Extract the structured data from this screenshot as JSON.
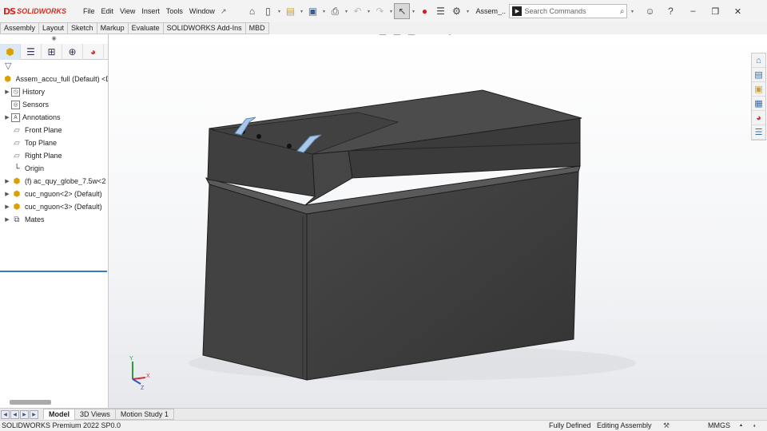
{
  "app": {
    "logo_mark": "DS",
    "logo_text": "SOLIDWORKS",
    "menu": [
      "File",
      "Edit",
      "View",
      "Insert",
      "Tools",
      "Window"
    ],
    "document_title": "Assem_...",
    "search_placeholder": "Search Commands",
    "accent_color": "#d52b1e"
  },
  "command_tabs": [
    "Assembly",
    "Layout",
    "Sketch",
    "Markup",
    "Evaluate",
    "SOLIDWORKS Add-Ins",
    "MBD"
  ],
  "feature_tree": {
    "root": "Assem_accu_full (Default) <D",
    "items": [
      {
        "label": "History",
        "icon": "history-icon",
        "expandable": true
      },
      {
        "label": "Sensors",
        "icon": "sensor-icon",
        "expandable": false
      },
      {
        "label": "Annotations",
        "icon": "annotation-icon",
        "expandable": true
      },
      {
        "label": "Front Plane",
        "icon": "plane-icon",
        "expandable": false
      },
      {
        "label": "Top Plane",
        "icon": "plane-icon",
        "expandable": false
      },
      {
        "label": "Right Plane",
        "icon": "plane-icon",
        "expandable": false
      },
      {
        "label": "Origin",
        "icon": "origin-icon",
        "expandable": false
      },
      {
        "label": "(f) ac_quy_globe_7.5w<2",
        "icon": "part-icon",
        "expandable": true
      },
      {
        "label": "cuc_nguon<2> (Default)",
        "icon": "part-icon",
        "expandable": true
      },
      {
        "label": "cuc_nguon<3> (Default)",
        "icon": "part-icon",
        "expandable": true
      },
      {
        "label": "Mates",
        "icon": "mates-icon",
        "expandable": true
      }
    ]
  },
  "bottom_tabs": [
    "Model",
    "3D Views",
    "Motion Study 1"
  ],
  "status": {
    "version": "SOLIDWORKS Premium 2022 SP0.0",
    "definition": "Fully Defined",
    "mode": "Editing Assembly",
    "units": "MMGS"
  },
  "triad": {
    "x": "X",
    "y": "Y",
    "z": "Z"
  }
}
